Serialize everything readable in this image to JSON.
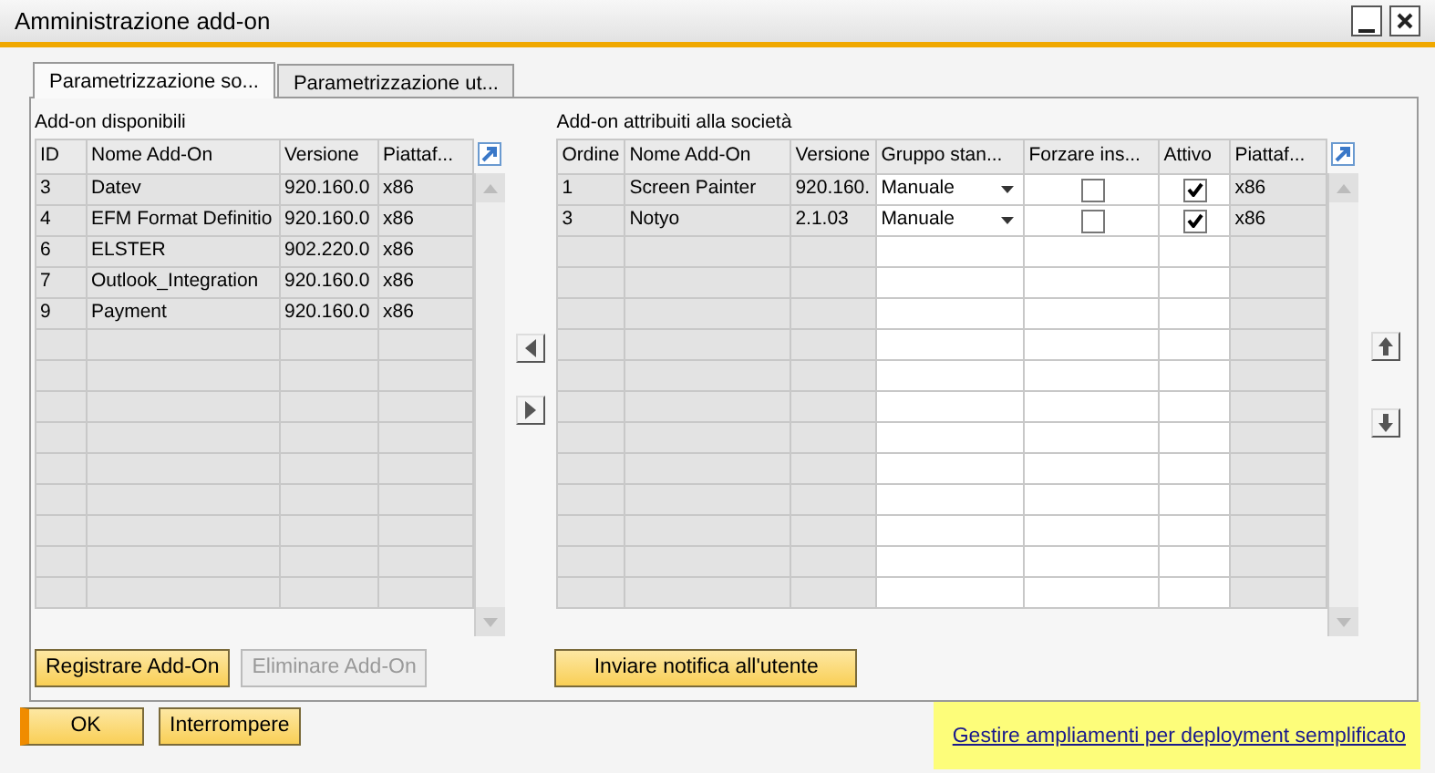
{
  "window": {
    "title": "Amministrazione add-on"
  },
  "tabs": [
    {
      "label": "Parametrizzazione so...",
      "selected": true
    },
    {
      "label": "Parametrizzazione ut...",
      "selected": false
    }
  ],
  "available": {
    "title": "Add-on disponibili",
    "columns": [
      "ID",
      "Nome Add-On",
      "Versione",
      "Piattaf..."
    ],
    "rows": [
      [
        "3",
        "Datev",
        "920.160.0",
        "x86"
      ],
      [
        "4",
        "EFM Format Definitio",
        "920.160.0",
        "x86"
      ],
      [
        "6",
        "ELSTER",
        "902.220.0",
        "x86"
      ],
      [
        "7",
        "Outlook_Integration",
        "920.160.0",
        "x86"
      ],
      [
        "9",
        "Payment",
        "920.160.0",
        "x86"
      ]
    ]
  },
  "assigned": {
    "title": "Add-on attribuiti alla società",
    "columns": [
      "Ordine",
      "Nome Add-On",
      "Versione",
      "Gruppo stan...",
      "Forzare ins...",
      "Attivo",
      "Piattaf..."
    ],
    "rows": [
      {
        "order": "1",
        "name": "Screen Painter",
        "version": "920.160.",
        "group": "Manuale",
        "forced": false,
        "active": true,
        "platform": "x86"
      },
      {
        "order": "3",
        "name": "Notyo",
        "version": "2.1.03",
        "group": "Manuale",
        "forced": false,
        "active": true,
        "platform": "x86"
      }
    ]
  },
  "panel_buttons": [
    {
      "label": "Registrare Add-On",
      "disabled": false
    },
    {
      "label": "Eliminare Add-On",
      "disabled": true
    },
    {
      "label": "Inviare notifica all'utente",
      "disabled": false
    }
  ],
  "footer_buttons": [
    {
      "label": "OK",
      "default": true
    },
    {
      "label": "Interrompere",
      "default": false
    }
  ],
  "link": "Gestire ampliamenti per deployment semplificato"
}
